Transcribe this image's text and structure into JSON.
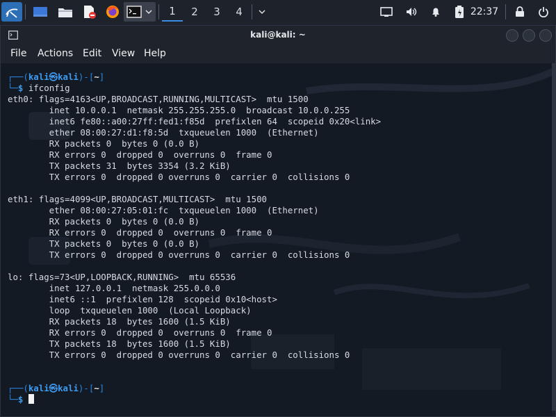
{
  "panel": {
    "workspaces": [
      "1",
      "2",
      "3",
      "4"
    ],
    "clock": "22:37",
    "icons": {
      "menu": "kali-dragon-icon",
      "show_desktop": "desktop-icon",
      "files": "folder-icon",
      "editor": "text-editor-icon",
      "browser": "firefox-icon",
      "terminal": "terminal-icon",
      "dropdown": "chevron-down-icon",
      "screen": "display-icon",
      "volume": "volume-icon",
      "notifications": "bell-icon",
      "battery": "battery-icon",
      "lock": "lock-icon",
      "power": "power-icon"
    }
  },
  "window": {
    "title": "kali@kali: ~",
    "menus": [
      "File",
      "Actions",
      "Edit",
      "View",
      "Help"
    ]
  },
  "terminal": {
    "prompt_top": "┌──(",
    "prompt_user": "kali㉿kali",
    "prompt_close": ")-[",
    "prompt_dir": "~",
    "prompt_end": "]",
    "prompt_bottom": "└─",
    "prompt_symbol": "$",
    "command": " ifconfig",
    "output": [
      "eth0: flags=4163<UP,BROADCAST,RUNNING,MULTICAST>  mtu 1500",
      "        inet 10.0.0.1  netmask 255.255.255.0  broadcast 10.0.0.255",
      "        inet6 fe80::a00:27ff:fed1:f85d  prefixlen 64  scopeid 0x20<link>",
      "        ether 08:00:27:d1:f8:5d  txqueuelen 1000  (Ethernet)",
      "        RX packets 0  bytes 0 (0.0 B)",
      "        RX errors 0  dropped 0  overruns 0  frame 0",
      "        TX packets 31  bytes 3354 (3.2 KiB)",
      "        TX errors 0  dropped 0 overruns 0  carrier 0  collisions 0",
      "",
      "eth1: flags=4099<UP,BROADCAST,MULTICAST>  mtu 1500",
      "        ether 08:00:27:05:01:fc  txqueuelen 1000  (Ethernet)",
      "        RX packets 0  bytes 0 (0.0 B)",
      "        RX errors 0  dropped 0  overruns 0  frame 0",
      "        TX packets 0  bytes 0 (0.0 B)",
      "        TX errors 0  dropped 0 overruns 0  carrier 0  collisions 0",
      "",
      "lo: flags=73<UP,LOOPBACK,RUNNING>  mtu 65536",
      "        inet 127.0.0.1  netmask 255.0.0.0",
      "        inet6 ::1  prefixlen 128  scopeid 0x10<host>",
      "        loop  txqueuelen 1000  (Local Loopback)",
      "        RX packets 18  bytes 1600 (1.5 KiB)",
      "        RX errors 0  dropped 0  overruns 0  frame 0",
      "        TX packets 18  bytes 1600 (1.5 KiB)",
      "        TX errors 0  dropped 0 overruns 0  carrier 0  collisions 0"
    ]
  },
  "colors": {
    "prompt_frame": "#2b86e0",
    "prompt_user": "#3d9bf0",
    "text": "#d8dbe0",
    "background": "#131a24",
    "active_workspace": "#3a8ee6"
  }
}
